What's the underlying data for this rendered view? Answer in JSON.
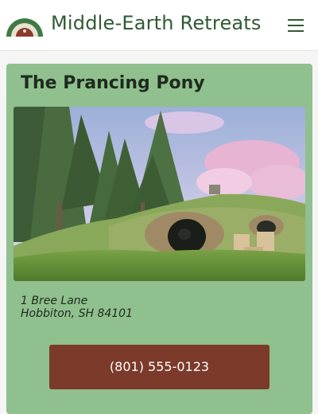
{
  "header": {
    "brand_name": "Middle-Earth Retreats",
    "logo_icon": "hobbit-door-logo-icon",
    "menu_icon": "hamburger-menu-icon"
  },
  "listing": {
    "title": "The Prancing Pony",
    "photo_icon": "hobbit-hole-photo",
    "address": {
      "line1": "1 Bree Lane",
      "line2": "Hobbiton, SH 84101"
    },
    "phone_label": "(801) 555-0123"
  },
  "colors": {
    "brand": "#2f5a35",
    "card_background": "#8fc08d",
    "button_background": "#7b3a2a",
    "button_text": "#ffffff"
  }
}
